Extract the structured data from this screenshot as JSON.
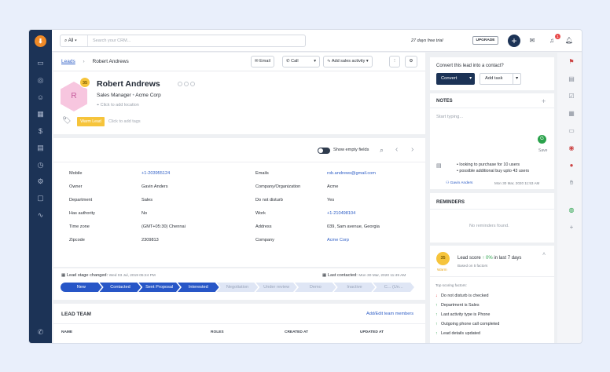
{
  "search": {
    "scope": "All",
    "placeholder": "Search your CRM..."
  },
  "topbar": {
    "trial_text": "27 days free trial",
    "upgrade_label": "UPGRADE",
    "notif_count": "1",
    "avatar_initial": "G"
  },
  "breadcrumb": {
    "parent": "Leads",
    "current": "Robert Andrews"
  },
  "actions": {
    "email": "Email",
    "call": "Call",
    "add_activity": "Add sales activity"
  },
  "lead": {
    "initial": "R",
    "score": "35",
    "name": "Robert Andrews",
    "title": "Sales Manager",
    "company": "Acme Corp",
    "location_placeholder": "Click to add location",
    "tag": "Warm Lead",
    "tags_placeholder": "Click to add tags"
  },
  "details_toolbar": {
    "show_empty_fields": "Show empty fields"
  },
  "details": [
    {
      "label": "Mobile",
      "value": "+1-203955124",
      "link": true
    },
    {
      "label": "Owner",
      "value": "Gavin Anders",
      "link": false
    },
    {
      "label": "Department",
      "value": "Sales",
      "link": false
    },
    {
      "label": "Has authority",
      "value": "No",
      "link": false
    },
    {
      "label": "Time zone",
      "value": "(GMT+05:30) Chennai",
      "link": false
    },
    {
      "label": "Zipcode",
      "value": "2309813",
      "link": false
    },
    {
      "label": "Emails",
      "value": "rob.andrews@gmail.com",
      "link": true
    },
    {
      "label": "Company/Organization",
      "value": "Acme",
      "link": false
    },
    {
      "label": "Do not disturb",
      "value": "Yes",
      "link": false
    },
    {
      "label": "Work",
      "value": "+1-210498104",
      "link": true
    },
    {
      "label": "Address",
      "value": "039, Sam avenue, Georgia",
      "link": false
    },
    {
      "label": "Company",
      "value": "Acme Corp",
      "link": true
    }
  ],
  "pipeline": {
    "stage_changed_label": "Lead stage changed:",
    "stage_changed_date": "Wed 03 Jul, 2019 05:24 PM",
    "last_contacted_label": "Last contacted:",
    "last_contacted_date": "Mon 30 Mar, 2020 11:49 AM",
    "stages": [
      "New",
      "Contacted",
      "Sent Proposal",
      "Interested",
      "Negotiation",
      "Under review",
      "Demo",
      "Inactive",
      "C... (Un..."
    ],
    "completed": 4
  },
  "lead_team": {
    "title": "LEAD TEAM",
    "add_edit": "Add/Edit team members",
    "columns": [
      "NAME",
      "ROLES",
      "CREATED AT",
      "UPDATED AT"
    ]
  },
  "convert": {
    "prompt": "Convert this lead into a contact?",
    "button": "Convert",
    "add_task": "Add task"
  },
  "notes": {
    "title": "NOTES",
    "placeholder": "Start typing...",
    "save": "Save",
    "grammar_icon": "G",
    "bullets": [
      "looking to purchase for 10 users",
      "possible additional buy upto 43 users"
    ],
    "author": "Gavin Anders",
    "timestamp": "Mon 30 Mar, 2020 11:53 AM"
  },
  "reminders": {
    "title": "REMINDERS",
    "empty": "No reminders found."
  },
  "lead_score": {
    "score": "35",
    "tag": "Warm",
    "title": "Lead score",
    "change": "0%",
    "period": "in last 7 days",
    "based_on": "Based on 5 factors",
    "factors_title": "Top scoring factors:",
    "factors": [
      {
        "text": "Do not disturb is checked",
        "direction": "down"
      },
      {
        "text": "Department is Sales",
        "direction": "up"
      },
      {
        "text": "Last activity type is Phone",
        "direction": "up"
      },
      {
        "text": "Outgoing phone call completed",
        "direction": "up"
      },
      {
        "text": "Lead details updated",
        "direction": "up"
      }
    ]
  },
  "colors": {
    "navy": "#1c3356",
    "blue": "#2756c7",
    "link": "#2c5cc5",
    "warm": "#f6c43b",
    "green": "#2aa24b",
    "red": "#e84a4a"
  }
}
